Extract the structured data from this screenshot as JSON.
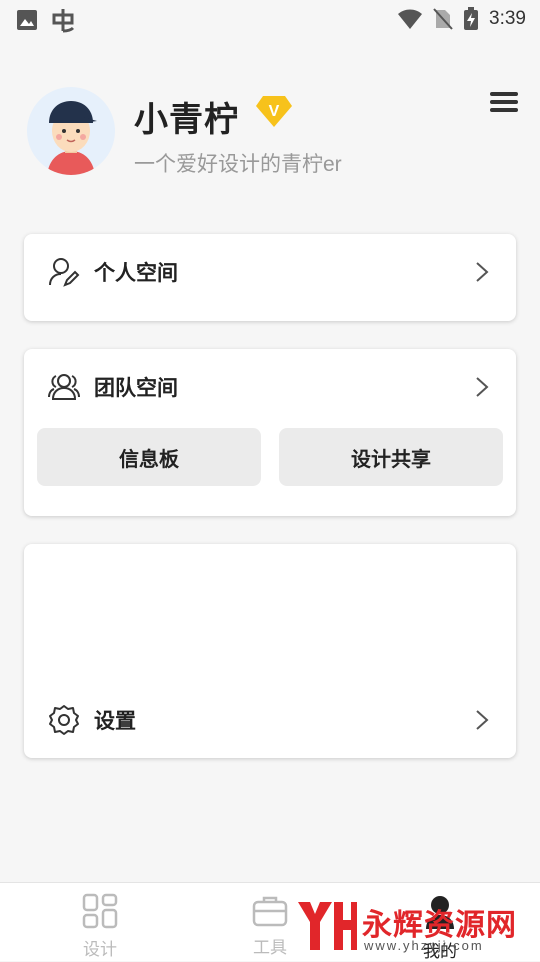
{
  "status_bar": {
    "time": "3:39"
  },
  "profile": {
    "name": "小青柠",
    "bio": "一个爱好设计的青柠er",
    "badge": "V"
  },
  "cards": {
    "personal": {
      "label": "个人空间"
    },
    "team": {
      "label": "团队空间",
      "buttons": [
        "信息板",
        "设计共享"
      ]
    },
    "settings": {
      "label": "设置"
    }
  },
  "bottom_nav": {
    "items": [
      {
        "label": "设计",
        "icon": "grid-icon"
      },
      {
        "label": "工具",
        "icon": "briefcase-icon"
      },
      {
        "label": "我的",
        "icon": "user-icon",
        "active": true
      }
    ]
  },
  "watermark": {
    "text": "永辉资源网",
    "url": "www.yhzyjj.com"
  },
  "colors": {
    "accent_badge": "#f7c21b",
    "watermark": "#e1262a"
  }
}
